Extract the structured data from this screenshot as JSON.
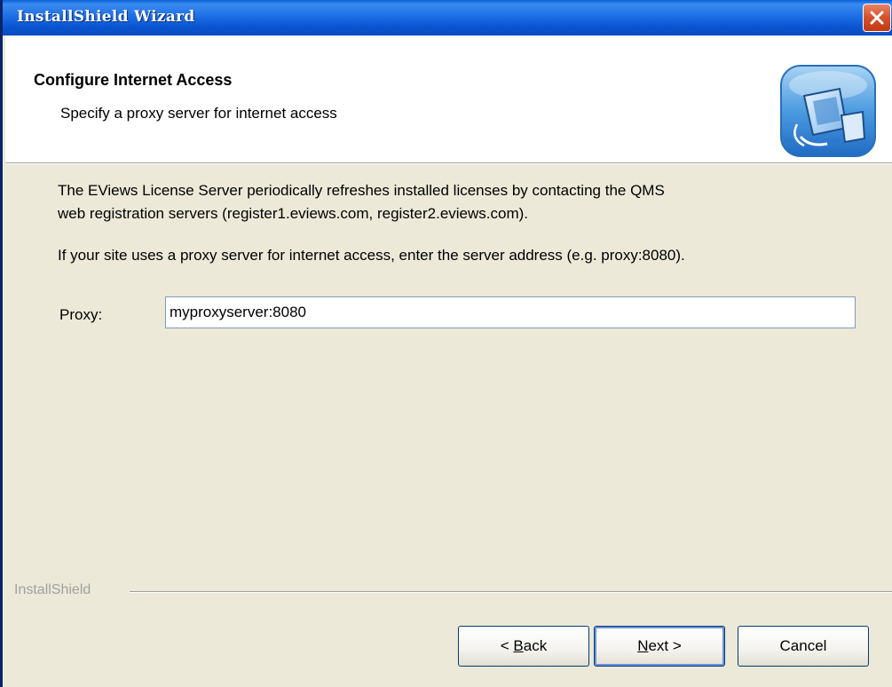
{
  "window": {
    "title": "InstallShield Wizard",
    "close_icon": "close-icon",
    "title_color": "#0A5FD8",
    "close_color": "#D4502A"
  },
  "header": {
    "title": "Configure Internet Access",
    "subtitle": "Specify a proxy server for internet access",
    "icon": "computer-network-icon"
  },
  "body": {
    "paragraph1_line1": "The EViews License Server periodically refreshes installed licenses by contacting the QMS",
    "paragraph1_line2": "web registration servers (register1.eviews.com, register2.eviews.com).",
    "paragraph2": "If your site uses a proxy server for internet access, enter the server address (e.g. proxy:8080)."
  },
  "proxy": {
    "label": "Proxy:",
    "value": "myproxyserver:8080"
  },
  "footer": {
    "brand": "InstallShield",
    "back_label_prefix": "< ",
    "back_label_accel": "B",
    "back_label_rest": "ack",
    "next_label_accel": "N",
    "next_label_rest": "ext >",
    "cancel_label": "Cancel"
  }
}
